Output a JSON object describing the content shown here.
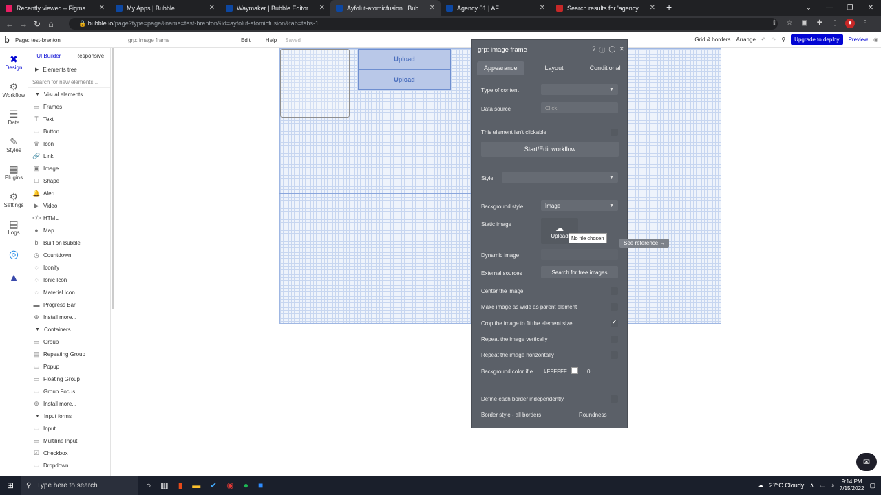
{
  "browser": {
    "tabs": [
      {
        "title": "Recently viewed – Figma",
        "color": "#e91e63"
      },
      {
        "title": "My Apps | Bubble",
        "color": "#0d47a1"
      },
      {
        "title": "Waymaker | Bubble Editor",
        "color": "#0d47a1"
      },
      {
        "title": "Ayfolut-atomicfusion | Bubble Ed",
        "color": "#0d47a1"
      },
      {
        "title": "Agency 01 | AF",
        "color": "#0d47a1"
      },
      {
        "title": "Search results for 'agency landin",
        "color": "#c62828"
      }
    ],
    "url_host": "bubble.io",
    "url_path": "/page?type=page&name=test-brenton&id=ayfolut-atomicfusion&tab=tabs-1"
  },
  "header": {
    "page_label": "Page: test-brenton",
    "element_label": "grp: image frame",
    "edit": "Edit",
    "help": "Help",
    "saved": "Saved",
    "grid_borders": "Grid & borders",
    "arrange": "Arrange",
    "upgrade": "Upgrade to deploy",
    "preview": "Preview"
  },
  "rail": [
    {
      "label": "Design",
      "icon": "✖"
    },
    {
      "label": "Workflow",
      "icon": "⚙"
    },
    {
      "label": "Data",
      "icon": "☰"
    },
    {
      "label": "Styles",
      "icon": "✎"
    },
    {
      "label": "Plugins",
      "icon": "▦"
    },
    {
      "label": "Settings",
      "icon": "⚙"
    },
    {
      "label": "Logs",
      "icon": "▤"
    }
  ],
  "left_panel": {
    "tab_ui": "UI Builder",
    "tab_responsive": "Responsive",
    "elements_tree": "Elements tree",
    "search_placeholder": "Search for new elements...",
    "sections": {
      "visual": "Visual elements",
      "containers": "Containers",
      "inputs": "Input forms"
    },
    "visual_items": [
      {
        "icon": "▭",
        "label": "Frames"
      },
      {
        "icon": "T",
        "label": "Text"
      },
      {
        "icon": "▭",
        "label": "Button"
      },
      {
        "icon": "♛",
        "label": "Icon"
      },
      {
        "icon": "🔗",
        "label": "Link"
      },
      {
        "icon": "▣",
        "label": "Image"
      },
      {
        "icon": "□",
        "label": "Shape"
      },
      {
        "icon": "🔔",
        "label": "Alert"
      },
      {
        "icon": "▶",
        "label": "Video"
      },
      {
        "icon": "</>",
        "label": "HTML"
      },
      {
        "icon": "●",
        "label": "Map"
      },
      {
        "icon": "b",
        "label": "Built on Bubble"
      },
      {
        "icon": "◷",
        "label": "Countdown"
      },
      {
        "icon": "◌",
        "label": "Iconify"
      },
      {
        "icon": "◌",
        "label": "Ionic Icon"
      },
      {
        "icon": "◌",
        "label": "Material Icon"
      },
      {
        "icon": "▬",
        "label": "Progress Bar"
      },
      {
        "icon": "⊕",
        "label": "Install more..."
      }
    ],
    "container_items": [
      {
        "icon": "▭",
        "label": "Group"
      },
      {
        "icon": "▤",
        "label": "Repeating Group"
      },
      {
        "icon": "▭",
        "label": "Popup"
      },
      {
        "icon": "▭",
        "label": "Floating Group"
      },
      {
        "icon": "▭",
        "label": "Group Focus"
      },
      {
        "icon": "⊕",
        "label": "Install more..."
      }
    ],
    "input_items": [
      {
        "icon": "▭",
        "label": "Input"
      },
      {
        "icon": "▭",
        "label": "Multiline Input"
      },
      {
        "icon": "☑",
        "label": "Checkbox"
      },
      {
        "icon": "▭",
        "label": "Dropdown"
      }
    ]
  },
  "canvas": {
    "upload1": "Upload",
    "upload2": "Upload"
  },
  "editor": {
    "title": "grp: image frame",
    "tabs": [
      "Appearance",
      "Layout",
      "Conditional"
    ],
    "type_of_content": "Type of content",
    "data_source": "Data source",
    "data_source_value": "Click",
    "not_clickable": "This element isn't clickable",
    "workflow_btn": "Start/Edit workflow",
    "style": "Style",
    "bg_style": "Background style",
    "bg_style_value": "Image",
    "static_image": "Static image",
    "upload_label": "Upload",
    "tooltip": "No file chosen",
    "see_reference": "See reference →",
    "dynamic_image": "Dynamic image",
    "external_sources": "External sources",
    "search_free": "Search for free images",
    "center_image": "Center the image",
    "wide_parent": "Make image as wide as parent element",
    "crop": "Crop the image to fit the element size",
    "repeat_v": "Repeat the image vertically",
    "repeat_h": "Repeat the image horizontally",
    "bg_color_label": "Background color if e",
    "bg_color_value": "#FFFFFF",
    "bg_opacity": "0",
    "border_independent": "Define each border independently",
    "border_style": "Border style - all borders",
    "roundness": "Roundness"
  },
  "taskbar": {
    "search": "Type here to search",
    "weather": "27°C  Cloudy",
    "time": "9:14 PM",
    "date": "7/15/2022"
  }
}
